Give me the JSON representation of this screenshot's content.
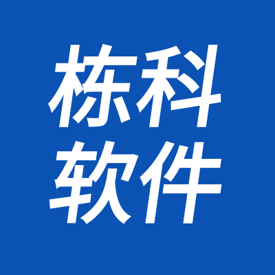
{
  "logo": {
    "line_1": "栋科",
    "line_2": "软件",
    "background_color": "#0b52b5",
    "text_color": "#ffffff"
  }
}
